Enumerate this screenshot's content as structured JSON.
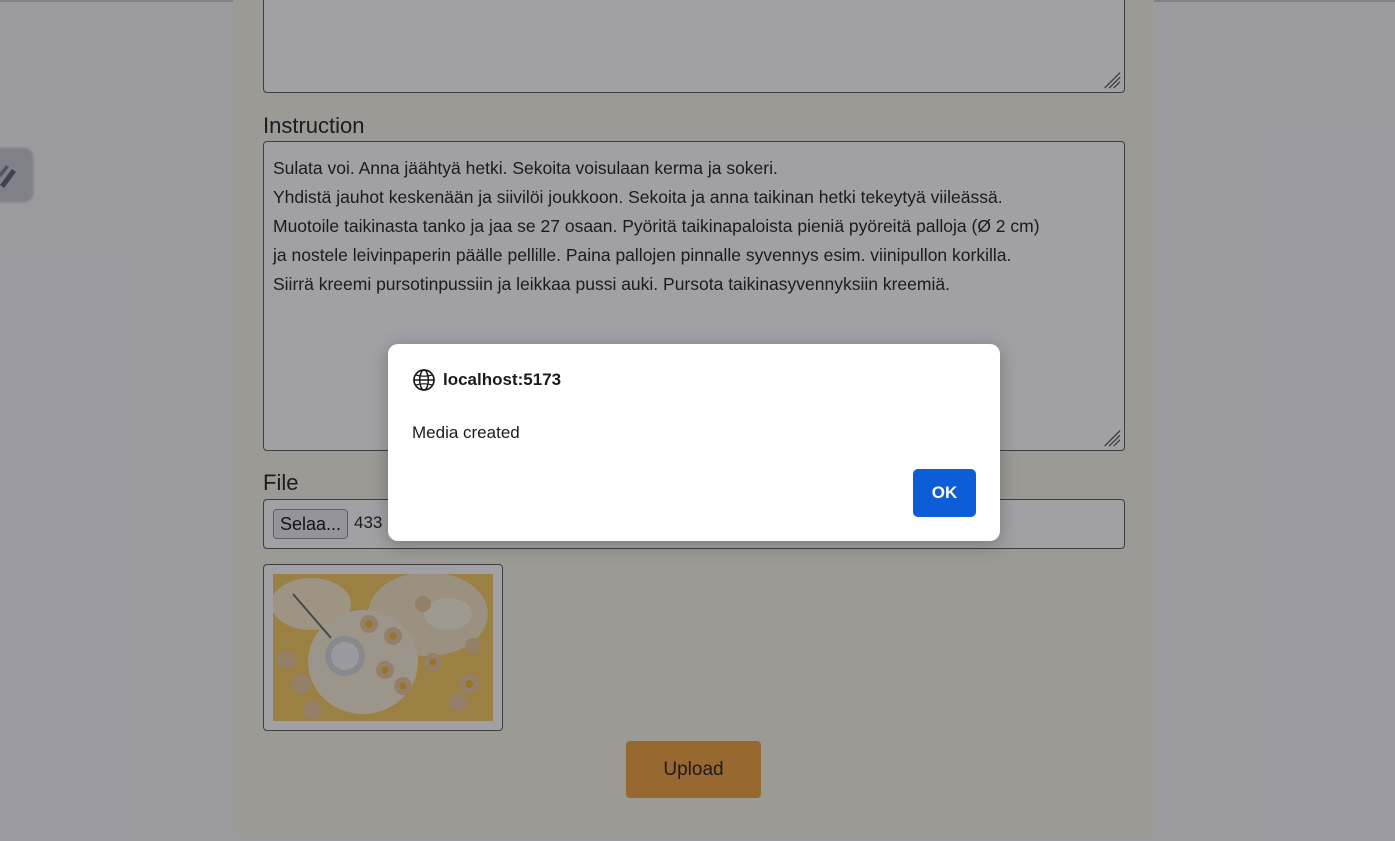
{
  "form": {
    "top_textarea_value": "",
    "instruction_label": "Instruction",
    "instruction_value": "Sulata voi. Anna jäähtyä hetki. Sekoita voisulaan kerma ja sokeri.\nYhdistä jauhot keskenään ja siivilöi joukkoon. Sekoita ja anna taikinan hetki tekeytyä viileässä.\nMuotoile taikinasta tanko ja jaa se 27 osaan. Pyöritä taikinapaloista pieniä pyöreitä palloja (Ø 2 cm)\nja nostele leivinpaperin päälle pellille. Paina pallojen pinnalle syvennys esim. viinipullon korkilla.\nSiirrä kreemi pursotinpussiin ja leikkaa pussi auki. Pursota taikinasyvennyksiin kreemiä.",
    "file_label": "File",
    "browse_label": "Selaa...",
    "file_name": "433",
    "upload_label": "Upload",
    "preview_icon": "cookies-photo"
  },
  "dialog": {
    "origin": "localhost:5173",
    "origin_icon": "globe-icon",
    "message": "Media created",
    "ok_label": "OK"
  },
  "colors": {
    "card_background": "#f7f3e4",
    "upload_button": "#f0a03e",
    "ok_button": "#0b5ed7",
    "overlay": "rgba(20,20,30,0.40)"
  }
}
